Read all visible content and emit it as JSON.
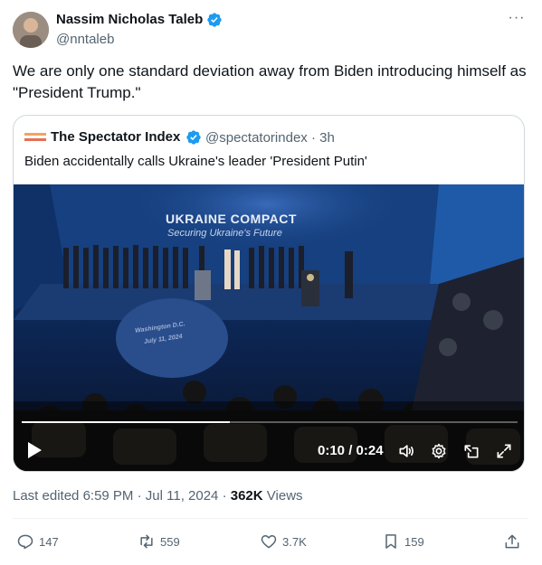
{
  "author": {
    "name": "Nassim Nicholas Taleb",
    "handle": "@nntaleb",
    "verified_color": "#1d9bf0"
  },
  "tweet": {
    "text": "We are only one standard deviation away from Biden introducing himself as \"President Trump.\"",
    "edited_label": "Last edited",
    "time": "6:59 PM",
    "date": "Jul 11, 2024",
    "views": "362K",
    "views_label": "Views"
  },
  "quoted": {
    "name": "The Spectator Index",
    "handle": "@spectatorindex",
    "age": "3h",
    "text": "Biden accidentally calls Ukraine's leader 'President Putin'",
    "video": {
      "banner_title": "UKRAINE COMPACT",
      "banner_subtitle": "Securing Ukraine's Future",
      "place": "Washington D.C.",
      "date": "July 11, 2024",
      "time": "0:10 / 0:24",
      "progress": 0.42
    }
  },
  "actions": {
    "replies": "147",
    "reposts": "559",
    "likes": "3.7K",
    "bookmarks": "159"
  }
}
